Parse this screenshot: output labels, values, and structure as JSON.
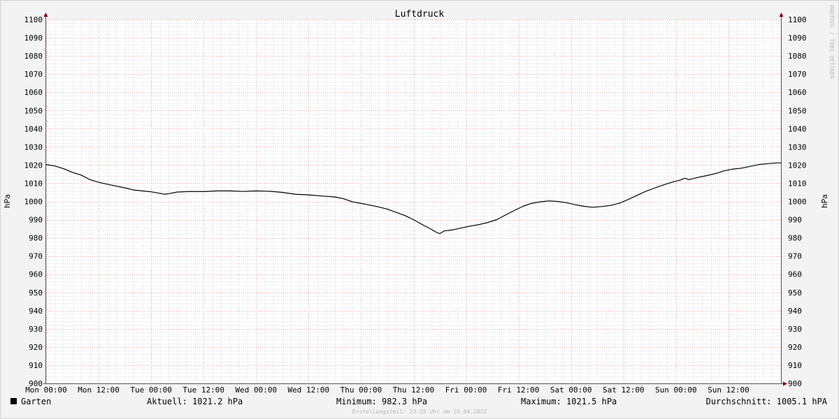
{
  "chart_data": {
    "type": "line",
    "title": "Luftdruck",
    "ylabel": "hPa",
    "ylabel_right": "hPa",
    "ylim": [
      900,
      1100
    ],
    "y_ticks": [
      900,
      910,
      920,
      930,
      940,
      950,
      960,
      970,
      980,
      990,
      1000,
      1010,
      1020,
      1030,
      1040,
      1050,
      1060,
      1070,
      1080,
      1090,
      1100
    ],
    "xlim_hours": [
      0,
      168
    ],
    "x_ticks": [
      {
        "label": "Mon 00:00"
      },
      {
        "label": "Mon 12:00"
      },
      {
        "label": "Tue 00:00"
      },
      {
        "label": "Tue 12:00"
      },
      {
        "label": "Wed 00:00"
      },
      {
        "label": "Wed 12:00"
      },
      {
        "label": "Thu 00:00"
      },
      {
        "label": "Thu 12:00"
      },
      {
        "label": "Fri 00:00"
      },
      {
        "label": "Fri 12:00"
      },
      {
        "label": "Sat 00:00"
      },
      {
        "label": "Sat 12:00"
      },
      {
        "label": "Sun 00:00"
      },
      {
        "label": "Sun 12:00"
      }
    ],
    "grid": true,
    "legend_position": "bottom-left",
    "series": [
      {
        "name": "Garten",
        "color": "#000000",
        "points": [
          [
            0,
            1020.3
          ],
          [
            2,
            1019.5
          ],
          [
            4,
            1018
          ],
          [
            6,
            1016
          ],
          [
            8,
            1014.5
          ],
          [
            10,
            1012
          ],
          [
            12,
            1010.5
          ],
          [
            14,
            1009.5
          ],
          [
            16,
            1008.5
          ],
          [
            18,
            1007.5
          ],
          [
            20,
            1006.3
          ],
          [
            22,
            1005.8
          ],
          [
            24,
            1005.3
          ],
          [
            26,
            1004.5
          ],
          [
            27,
            1004
          ],
          [
            28,
            1004.3
          ],
          [
            30,
            1005.2
          ],
          [
            33,
            1005.5
          ],
          [
            36,
            1005.4
          ],
          [
            39,
            1005.8
          ],
          [
            42,
            1005.8
          ],
          [
            45,
            1005.5
          ],
          [
            48,
            1005.8
          ],
          [
            51,
            1005.6
          ],
          [
            54,
            1005
          ],
          [
            57,
            1004
          ],
          [
            60,
            1003.6
          ],
          [
            63,
            1003
          ],
          [
            66,
            1002.5
          ],
          [
            68,
            1001.5
          ],
          [
            70,
            999.8
          ],
          [
            73,
            998.5
          ],
          [
            76,
            997
          ],
          [
            78,
            995.8
          ],
          [
            80,
            994
          ],
          [
            82,
            992.3
          ],
          [
            84,
            990
          ],
          [
            86,
            987.3
          ],
          [
            88,
            984.8
          ],
          [
            89,
            983.3
          ],
          [
            90,
            982.3
          ],
          [
            91,
            983.8
          ],
          [
            93,
            984.4
          ],
          [
            95,
            985.5
          ],
          [
            97,
            986.5
          ],
          [
            99,
            987.3
          ],
          [
            101,
            988.5
          ],
          [
            103,
            990
          ],
          [
            105,
            992.5
          ],
          [
            107,
            995
          ],
          [
            109,
            997.3
          ],
          [
            111,
            999
          ],
          [
            113,
            999.8
          ],
          [
            115,
            1000.3
          ],
          [
            117,
            1000
          ],
          [
            119,
            999.3
          ],
          [
            121,
            998.2
          ],
          [
            123,
            997.3
          ],
          [
            125,
            996.8
          ],
          [
            127,
            997.2
          ],
          [
            129,
            997.8
          ],
          [
            131,
            999
          ],
          [
            133,
            1001
          ],
          [
            135,
            1003.3
          ],
          [
            137,
            1005.5
          ],
          [
            139,
            1007.3
          ],
          [
            141,
            1009
          ],
          [
            143,
            1010.5
          ],
          [
            145,
            1011.8
          ],
          [
            146,
            1012.8
          ],
          [
            147,
            1012
          ],
          [
            149,
            1013.2
          ],
          [
            151,
            1014.2
          ],
          [
            153,
            1015.3
          ],
          [
            155,
            1016.8
          ],
          [
            157,
            1017.8
          ],
          [
            159,
            1018.3
          ],
          [
            161,
            1019.3
          ],
          [
            163,
            1020.3
          ],
          [
            165,
            1020.8
          ],
          [
            167,
            1021.2
          ],
          [
            168,
            1021.2
          ]
        ]
      }
    ]
  },
  "legend": {
    "series_name": "Garten",
    "swatch_color": "#000000",
    "aktuell": "Aktuell: 1021.2 hPa",
    "minimum": "Minimum: 982.3 hPa",
    "maximum": "Maximum: 1021.5 hPa",
    "durchschnitt": "Durchschnitt: 1005.1 hPA"
  },
  "footer": {
    "created": "Erstellungszeit: 23:55 Uhr am 10.04.2022"
  },
  "watermark": "RRDTOOL / TOBI OETIKER",
  "colors": {
    "background": "#f3f3f3",
    "canvas": "#ffffff",
    "major_grid": "#e6a0a0",
    "minor_grid": "#d9d9d9",
    "axis": "#555555",
    "arrow": "#8b0000",
    "line": "#000000",
    "faint_text": "#b8b8b8"
  }
}
